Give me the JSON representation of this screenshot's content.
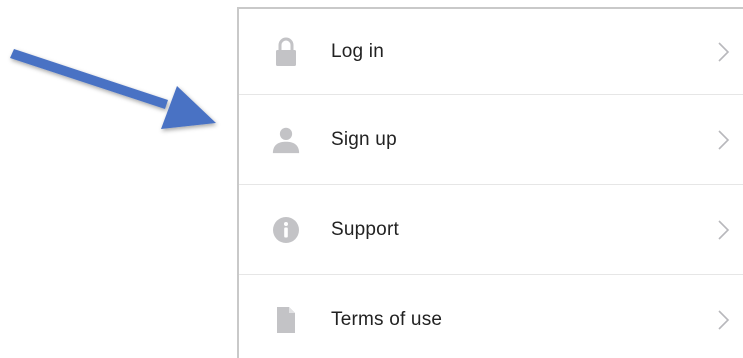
{
  "menu": {
    "items": [
      {
        "label": "Log in",
        "icon": "lock-icon"
      },
      {
        "label": "Sign up",
        "icon": "user-icon"
      },
      {
        "label": "Support",
        "icon": "info-icon"
      },
      {
        "label": "Terms of use",
        "icon": "document-icon"
      }
    ]
  },
  "colors": {
    "icon": "#c3c3c6",
    "chevron": "#b8b8bc",
    "text": "#222222",
    "divider": "#e6e6e6",
    "arrow": "#4a72c4"
  }
}
